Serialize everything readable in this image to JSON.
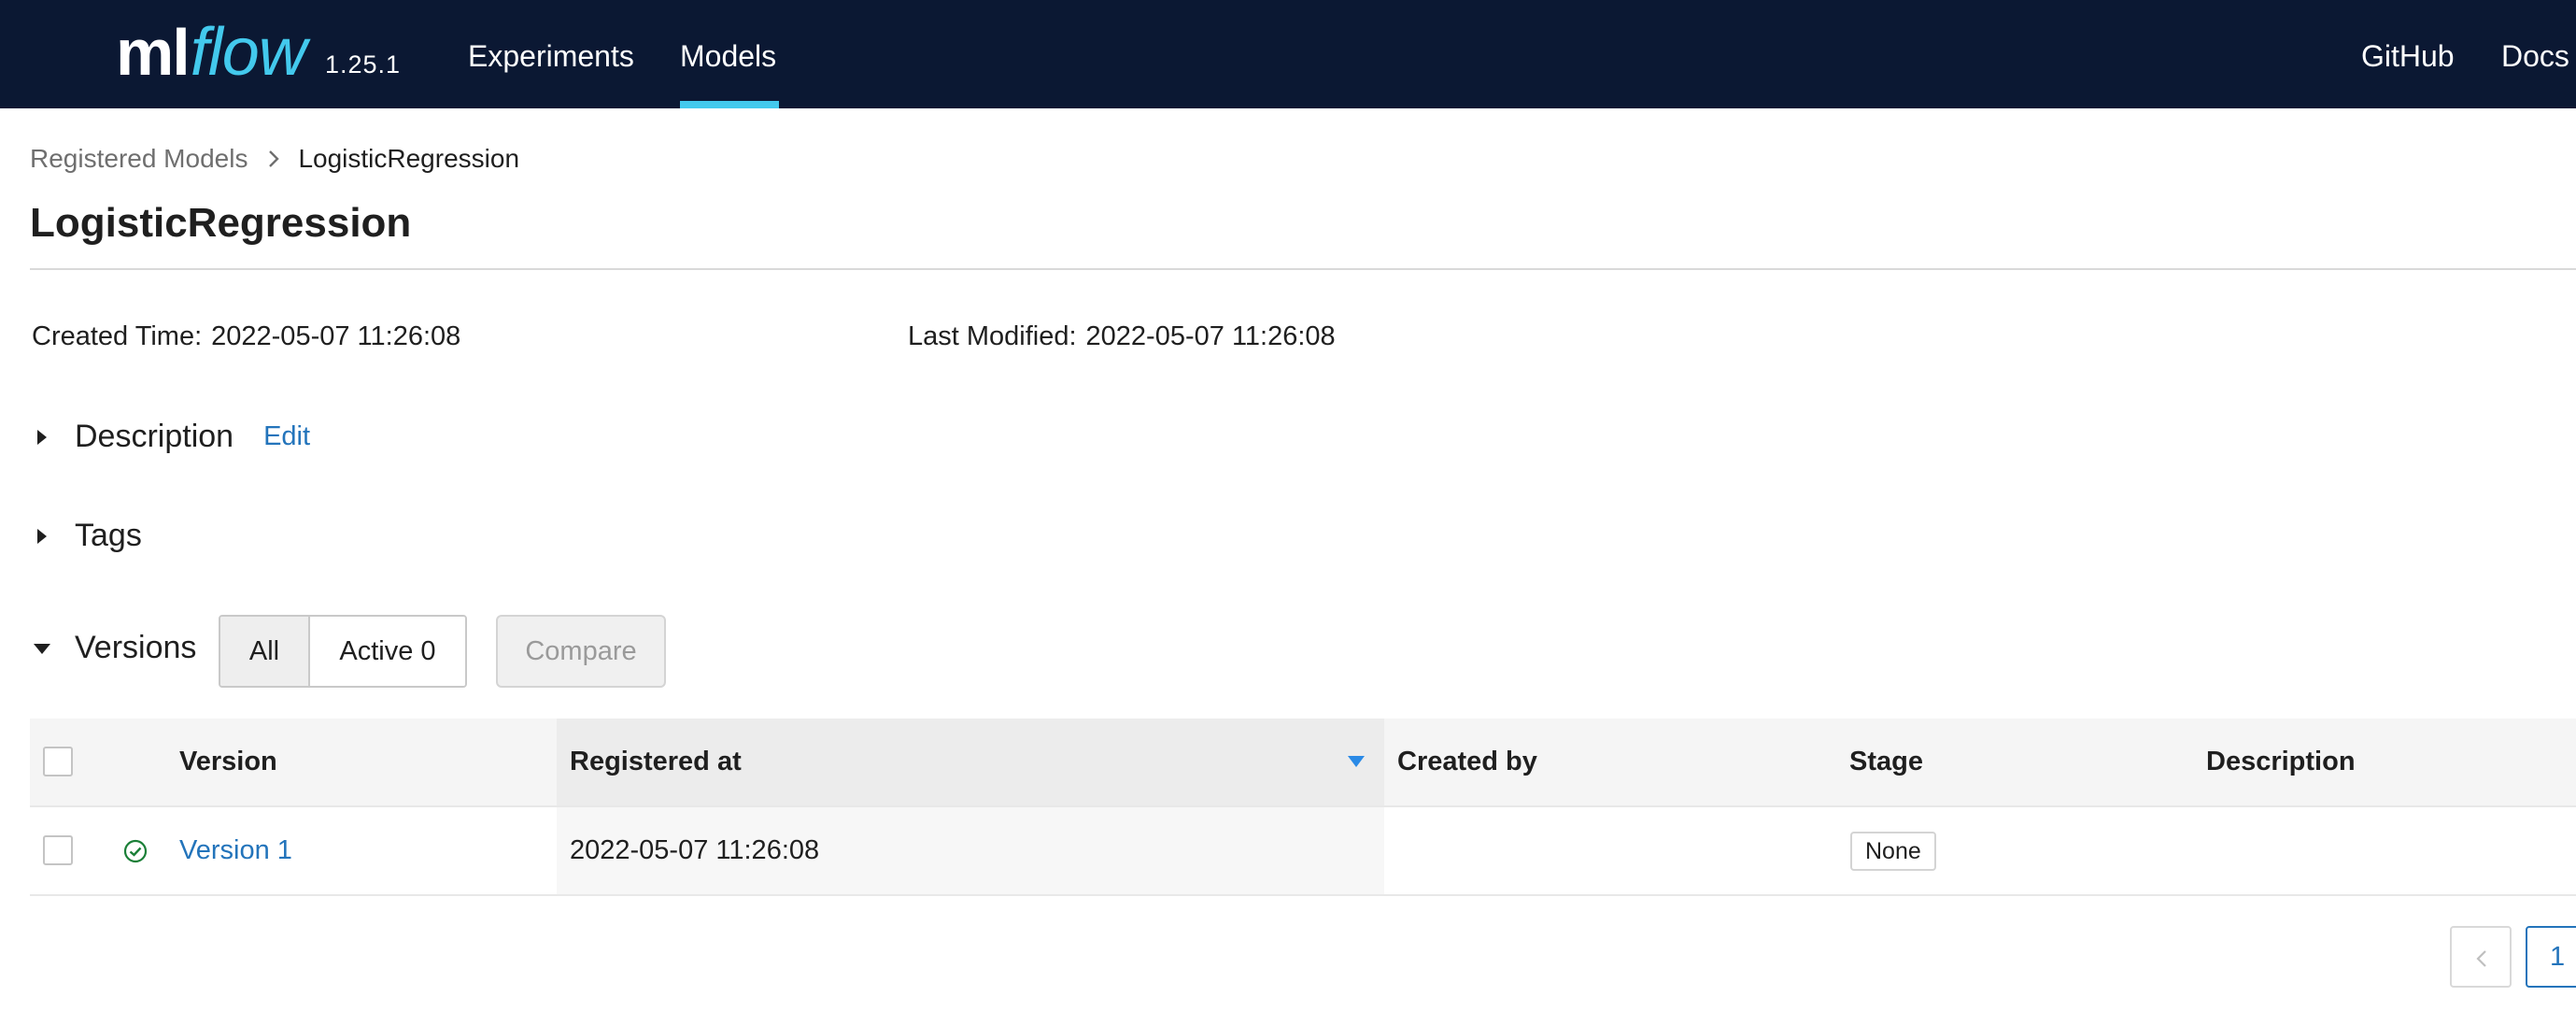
{
  "header": {
    "logo_ml": "ml",
    "logo_flow": "flow",
    "version": "1.25.1",
    "nav": [
      {
        "label": "Experiments",
        "active": false
      },
      {
        "label": "Models",
        "active": true
      }
    ],
    "right_links": [
      {
        "label": "GitHub"
      },
      {
        "label": "Docs"
      }
    ],
    "colors": {
      "background": "#0b1833",
      "accent": "#43c9ed"
    }
  },
  "breadcrumb": {
    "parent": "Registered Models",
    "separator_icon": "chevron-right-icon",
    "current": "LogisticRegression"
  },
  "page_title": "LogisticRegression",
  "metadata": {
    "created_label": "Created Time:",
    "created_value": "2022-05-07 11:26:08",
    "modified_label": "Last Modified:",
    "modified_value": "2022-05-07 11:26:08"
  },
  "sections": {
    "description": {
      "label": "Description",
      "edit_label": "Edit",
      "expanded": false
    },
    "tags": {
      "label": "Tags",
      "expanded": false
    },
    "versions": {
      "label": "Versions",
      "expanded": true
    }
  },
  "versions_filter": {
    "all_label": "All",
    "active_label": "Active 0",
    "selected": "All",
    "compare_label": "Compare",
    "compare_disabled": true
  },
  "table": {
    "columns": [
      "Version",
      "Registered at",
      "Created by",
      "Stage",
      "Description"
    ],
    "sorted_column": "Registered at",
    "sort_direction": "descending",
    "rows": [
      {
        "status_icon": "check-circle-icon",
        "version": "Version 1",
        "registered_at": "2022-05-07 11:26:08",
        "created_by": "",
        "stage": "None",
        "description": ""
      }
    ]
  },
  "pagination": {
    "prev_icon": "chevron-left-icon",
    "current_page": "1"
  },
  "colors": {
    "link": "#2374bb",
    "success": "#1a7f37"
  }
}
